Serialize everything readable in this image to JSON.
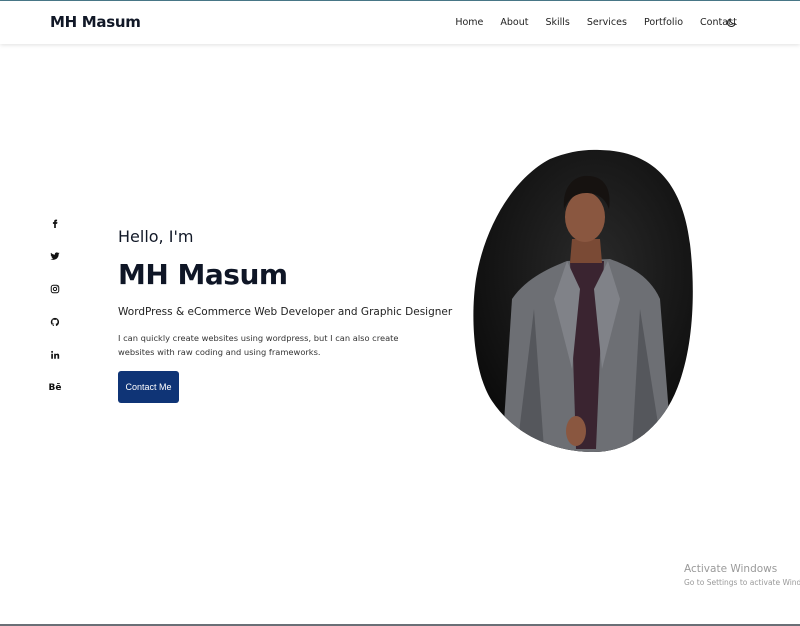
{
  "header": {
    "logo": "MH Masum",
    "nav": [
      "Home",
      "About",
      "Skills",
      "Services",
      "Portfolio",
      "Contact"
    ],
    "theme_toggle_icon": "moon-icon"
  },
  "social": {
    "icons": [
      "facebook-icon",
      "twitter-icon",
      "instagram-icon",
      "github-icon",
      "linkedin-icon",
      "behance-icon"
    ],
    "behance_text": "Bē"
  },
  "hero": {
    "greeting": "Hello, I'm",
    "name": "MH Masum",
    "subtitle": "WordPress & eCommerce Web Developer and Graphic Designer",
    "description": "I can quickly create websites using wordpress, but I can also create websites with raw coding and using frameworks.",
    "cta": "Contact Me"
  },
  "watermark": {
    "title": "Activate Windows",
    "subtitle": "Go to Settings to activate Windows."
  },
  "colors": {
    "accent": "#0f3476",
    "text_dark": "#0f1626",
    "photo_bg": "#141414"
  }
}
